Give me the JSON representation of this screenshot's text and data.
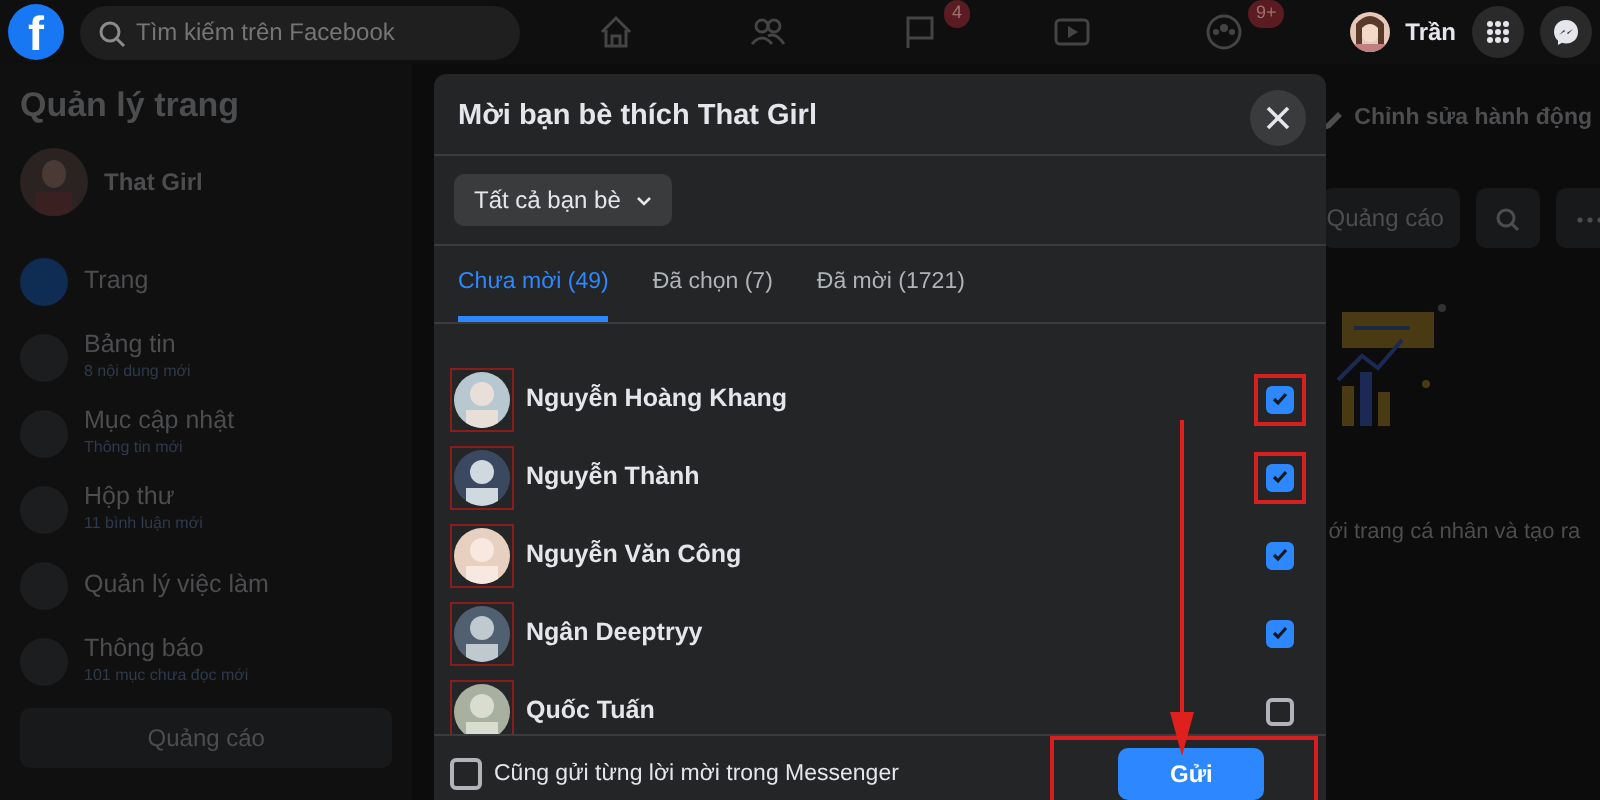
{
  "topbar": {
    "logo": "f",
    "search": {
      "placeholder": "Tìm kiếm trên Facebook"
    },
    "nav": [
      {
        "kind": "home"
      },
      {
        "kind": "friends"
      },
      {
        "kind": "flag",
        "badge": "4"
      },
      {
        "kind": "video"
      },
      {
        "kind": "groups",
        "badge": "9+"
      }
    ],
    "user": "Trần"
  },
  "sidebar": {
    "title": "Quản lý trang",
    "page_name": "That Girl",
    "items": [
      {
        "label": "Trang",
        "selected": true
      },
      {
        "label": "Bảng tin",
        "sub": "8 nội dung mới",
        "selected": false
      },
      {
        "label": "Mục cập nhật",
        "sub": "Thông tin mới",
        "selected": false
      },
      {
        "label": "Hộp thư",
        "sub": "11 bình luận mới",
        "selected": false
      },
      {
        "label": "Quản lý việc làm",
        "selected": false
      },
      {
        "label": "Thông báo",
        "sub": "101 mục chưa đọc mới",
        "selected": false
      }
    ],
    "button": "Quảng cáo"
  },
  "main": {
    "edit_action": "Chỉnh sửa hành động",
    "ad_button": "Quảng cáo",
    "text": "ới trang cá nhân và tạo ra"
  },
  "dialog": {
    "title": "Mời bạn bè thích That Girl",
    "filter": "Tất cả bạn bè",
    "tabs": [
      {
        "label": "Chưa mời (49)",
        "selected": true
      },
      {
        "label": "Đã chọn (7)",
        "selected": false
      },
      {
        "label": "Đã mời (1721)",
        "selected": false
      }
    ],
    "friends": [
      {
        "name": "Nguyễn Hoàng Khang",
        "checked": true,
        "highlighted": true
      },
      {
        "name": "Nguyễn Thành",
        "checked": true,
        "highlighted": true
      },
      {
        "name": "Nguyễn Văn Công",
        "checked": true,
        "highlighted": false
      },
      {
        "name": "Ngân Deeptryy",
        "checked": true,
        "highlighted": false
      },
      {
        "name": "Quốc Tuấn",
        "checked": false,
        "highlighted": false
      }
    ],
    "messenger_option": {
      "label": "Cũng gửi từng lời mời trong Messenger",
      "checked": false
    },
    "send_button": {
      "label": "Gửi",
      "highlighted": true
    }
  }
}
